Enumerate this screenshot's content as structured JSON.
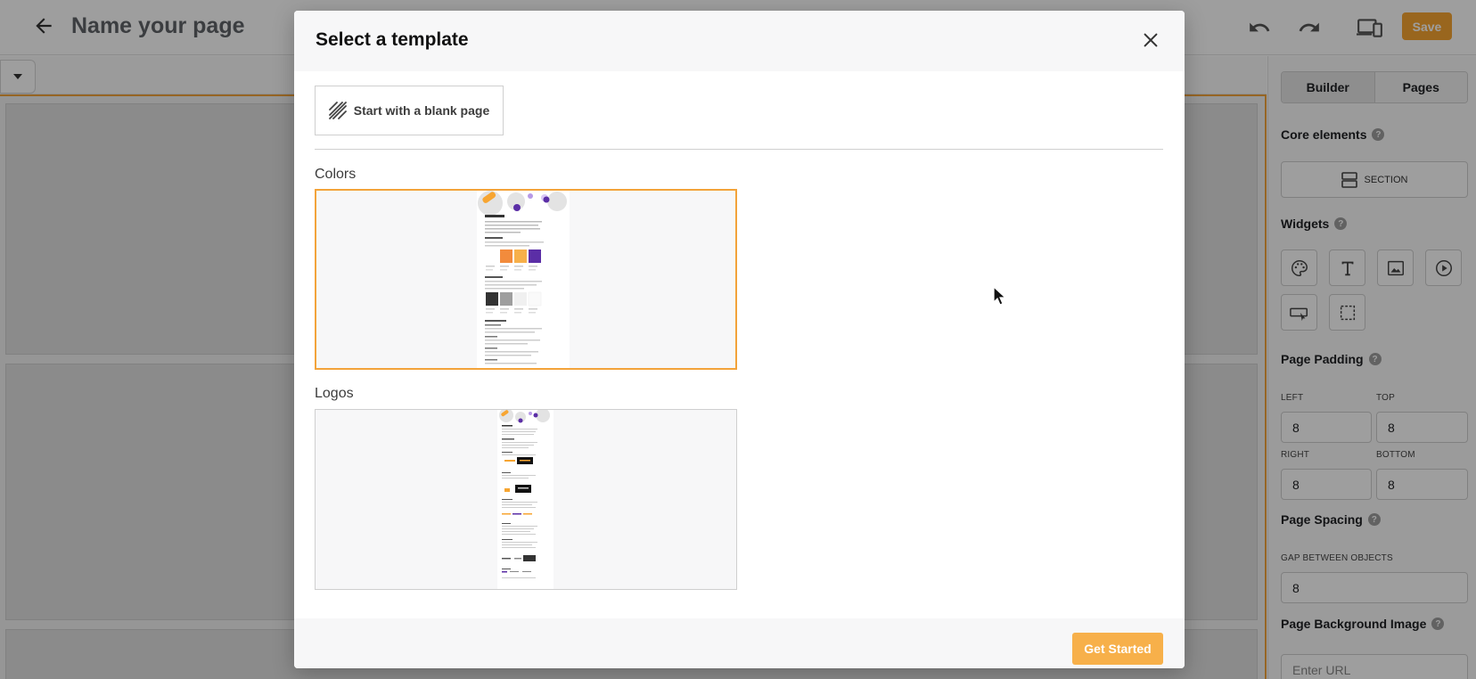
{
  "app": {
    "page_name": "Name your page",
    "save_label": "Save",
    "accent_color": "#f7a531"
  },
  "right_panel": {
    "tabs": [
      {
        "label": "Builder",
        "active": true
      },
      {
        "label": "Pages",
        "active": false
      }
    ],
    "core_elements": {
      "heading": "Core elements",
      "section_label": "SECTION"
    },
    "widgets": {
      "heading": "Widgets",
      "items": [
        "palette-icon",
        "text-icon",
        "image-icon",
        "video-icon",
        "button-icon",
        "container-icon"
      ]
    },
    "page_padding": {
      "heading": "Page Padding",
      "left_label": "LEFT",
      "left_value": "8",
      "top_label": "TOP",
      "top_value": "8",
      "right_label": "RIGHT",
      "right_value": "8",
      "bottom_label": "BOTTOM",
      "bottom_value": "8"
    },
    "page_spacing": {
      "heading": "Page Spacing",
      "gap_label": "GAP BETWEEN OBJECTS",
      "gap_value": "8"
    },
    "background_image": {
      "heading": "Page Background Image",
      "placeholder": "Enter URL"
    },
    "help_glyph": "?"
  },
  "modal": {
    "title": "Select a template",
    "blank_label": "Start with a blank page",
    "categories": [
      {
        "label": "Colors",
        "selected": true
      },
      {
        "label": "Logos",
        "selected": false
      }
    ],
    "get_started_label": "Get Started",
    "selected_border_color": "#f3a33a"
  }
}
